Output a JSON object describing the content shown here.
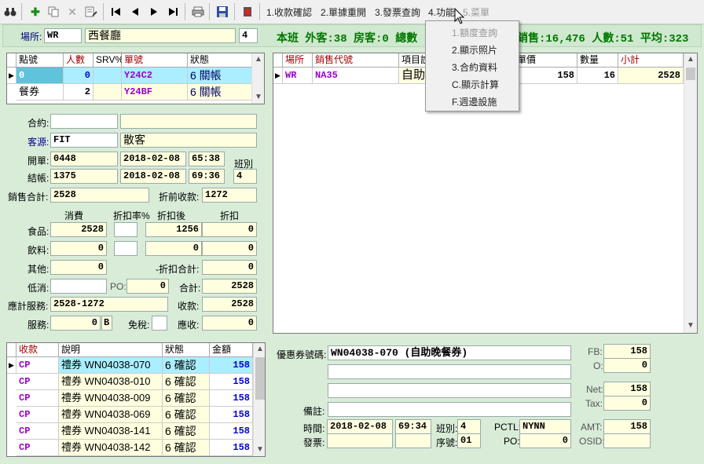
{
  "toolbar": {
    "menus": [
      "1.收款確認",
      "2.單據重開",
      "3.發票查詢",
      "4.功能",
      "5.菜單"
    ],
    "function_menu": [
      "1.額度查詢",
      "2.顯示照片",
      "3.合約資料",
      "C.顯示計算",
      "F.週邊設施"
    ]
  },
  "header": {
    "venue_label": "場所:",
    "venue_code": "WR",
    "venue_name": "西餐廳",
    "shift_no": "4",
    "summary_left": "本班 外客:38 房客:0 總數",
    "summary_right": "銷售:16,476 人數:51 平均:323"
  },
  "tables": {
    "columns": [
      "點號",
      "人數",
      "SRV%",
      "單號",
      "狀態"
    ],
    "rows": [
      {
        "no": "0",
        "pax": "0",
        "srv": "",
        "check": "Y24C2",
        "status": "6 關帳"
      },
      {
        "no": "餐券",
        "pax": "2",
        "srv": "",
        "check": "Y24BF",
        "status": "6 關帳"
      }
    ]
  },
  "form": {
    "contract_label": "合約:",
    "contract": "",
    "contract_name": "",
    "source_label": "客源:",
    "source": "FIT",
    "source_name": "散客",
    "open_label": "開單:",
    "open_no": "0448",
    "open_date": "2018-02-08",
    "open_time": "65:38",
    "close_label": "結帳:",
    "close_no": "1375",
    "close_date": "2018-02-08",
    "close_time": "69:36",
    "shift_label": "班別",
    "shift": "4",
    "sales_total_label": "銷售合計:",
    "sales_total": "2528",
    "pre_discount_label": "折前收款:",
    "pre_discount": "1272",
    "col_consume": "消費",
    "col_disc_rate": "折扣率%",
    "col_after_disc": "折扣後",
    "col_disc": "折扣",
    "food_label": "食品:",
    "food": "2528",
    "food_rate": "",
    "food_after": "1256",
    "food_disc": "0",
    "drink_label": "飲料:",
    "drink": "0",
    "drink_rate": "",
    "drink_after": "0",
    "drink_disc": "0",
    "other_label": "其他:",
    "other": "0",
    "disc_total_label": "-折扣合計:",
    "disc_total": "0",
    "min_label": "低消:",
    "min": "",
    "po_label": "PO:",
    "po": "0",
    "total_label": "合計:",
    "total": "2528",
    "service_calc_label": "應計服務:",
    "service_calc": "2528-1272",
    "receipt_label": "收款:",
    "receipt": "2528",
    "service_label": "服務:",
    "service": "0",
    "service_flag": "B",
    "tax_free_label": "免稅:",
    "tax_free": "",
    "receivable_label": "應收:",
    "receivable": "0"
  },
  "items": {
    "columns": [
      "場所",
      "銷售代號",
      "項目說",
      "單價",
      "數量",
      "小計"
    ],
    "rows": [
      {
        "venue": "WR",
        "code": "NA35",
        "item": "自助",
        "price": "158",
        "qty": "16",
        "subtotal": "2528"
      }
    ]
  },
  "payments": {
    "columns": [
      "收款",
      "說明",
      "狀態",
      "金額"
    ],
    "rows": [
      {
        "type": "CP",
        "desc": "禮券 WN04038-070",
        "status": "6 確認",
        "amount": "158"
      },
      {
        "type": "CP",
        "desc": "禮券 WN04038-010",
        "status": "6 確認",
        "amount": "158"
      },
      {
        "type": "CP",
        "desc": "禮券 WN04038-009",
        "status": "6 確認",
        "amount": "158"
      },
      {
        "type": "CP",
        "desc": "禮券 WN04038-069",
        "status": "6 確認",
        "amount": "158"
      },
      {
        "type": "CP",
        "desc": "禮券 WN04038-141",
        "status": "6 確認",
        "amount": "158"
      },
      {
        "type": "CP",
        "desc": "禮券 WN04038-142",
        "status": "6 確認",
        "amount": "158"
      }
    ]
  },
  "voucher": {
    "code_label": "優惠券號碼:",
    "code": "WN04038-070 (自助晚餐券)",
    "line2": "",
    "line3": "",
    "note_label": "備註:",
    "note": "",
    "time_label": "時間:",
    "date": "2018-02-08",
    "time": "69:34",
    "shift_label": "班別:",
    "shift": "4",
    "pctl_label": "PCTL:",
    "pctl": "NYNN",
    "invoice_label": "發票:",
    "invoice": "",
    "invoice2": "",
    "seq_label": "序號:",
    "seq": "01",
    "po_label": "PO:",
    "po": "0",
    "fb_label": "FB:",
    "fb": "158",
    "o_label": "O:",
    "o": "0",
    "net_label": "Net:",
    "net": "158",
    "tax_label": "Tax:",
    "tax": "0",
    "amt_label": "AMT:",
    "amt": "158",
    "osid_label": "OSID:",
    "osid": ""
  }
}
